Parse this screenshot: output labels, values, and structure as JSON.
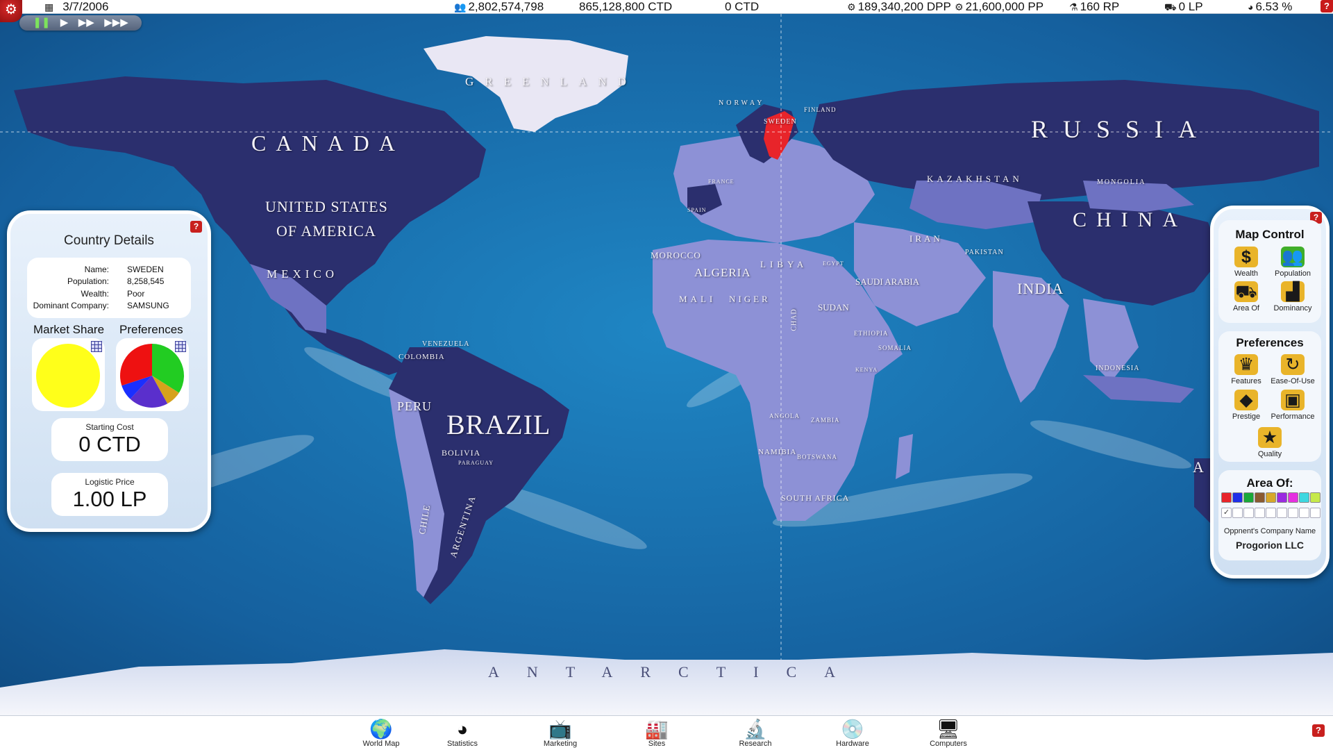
{
  "topbar": {
    "date": "3/7/2006",
    "population": "2,802,574,798",
    "money": "865,128,800 CTD",
    "money2": "0 CTD",
    "dpp": "189,340,200 DPP",
    "pp": "21,600,000 PP",
    "rp": "160 RP",
    "lp": "0 LP",
    "percent": "6.53 %",
    "help": "?"
  },
  "speed": {
    "pause": "❚❚",
    "play": "▶",
    "fast": "▶▶",
    "fastest": "▶▶▶"
  },
  "map_labels": {
    "greenland": "GREENLAND",
    "canada": "CANADA",
    "usa_line1": "UNITED STATES",
    "usa_line2": "OF AMERICA",
    "mexico": "MEXICO",
    "russia": "RUSSIA",
    "china": "CHINA",
    "kazakhstan": "KAZAKHSTAN",
    "mongolia": "MONGOLIA",
    "iran": "IRAN",
    "pakistan": "PAKISTAN",
    "india": "INDIA",
    "indonesia": "INDONESIA",
    "norway": "NORWAY",
    "finland": "FINLAND",
    "sweden": "SWEDEN",
    "france": "FRANCE",
    "spain": "SPAIN",
    "morocco": "MOROCCO",
    "algeria": "ALGERIA",
    "libya": "LIBYA",
    "egypt": "EGYPT",
    "saudi_arabia": "SAUDI ARABIA",
    "mali": "MALI",
    "niger": "NIGER",
    "chad": "CHAD",
    "sudan": "SUDAN",
    "ethiopia": "ETHIOPIA",
    "somalia": "SOMALIA",
    "kenya": "KENYA",
    "angola": "ANGOLA",
    "zambia": "ZAMBIA",
    "namibia": "NAMIBIA",
    "botswana": "BOTSWANA",
    "south_africa": "SOUTH AFRICA",
    "venezuela": "VENEZUELA",
    "colombia": "COLOMBIA",
    "peru": "PERU",
    "brazil": "BRAZIL",
    "bolivia": "BOLIVIA",
    "paraguay": "PARAGUAY",
    "chile": "CHILE",
    "argentina": "ARGENTINA",
    "antarctica": "ANTARCTICA",
    "australia": "A"
  },
  "country_details": {
    "title": "Country Details",
    "name_label": "Name:",
    "name": "SWEDEN",
    "population_label": "Population:",
    "population": "8,258,545",
    "wealth_label": "Wealth:",
    "wealth": "Poor",
    "dominant_label": "Dominant Company:",
    "dominant": "SAMSUNG",
    "market_share_label": "Market Share",
    "preferences_label": "Preferences",
    "starting_cost_label": "Starting Cost",
    "starting_cost": "0 CTD",
    "logistic_price_label": "Logistic Price",
    "logistic_price": "1.00 LP",
    "help": "?"
  },
  "market_share_pie": [
    {
      "name": "SAMSUNG",
      "value": 100,
      "color": "#ffff1a"
    }
  ],
  "preferences_pie": [
    {
      "value": 34,
      "color": "#22cc22"
    },
    {
      "value": 8,
      "color": "#d6a21c"
    },
    {
      "value": 20,
      "color": "#5a2fcc"
    },
    {
      "value": 8,
      "color": "#1a2fff"
    },
    {
      "value": 30,
      "color": "#ee1111"
    }
  ],
  "map_control": {
    "title": "Map Control",
    "wealth": "Wealth",
    "population": "Population",
    "area_of": "Area Of",
    "dominancy": "Dominancy",
    "preferences_title": "Preferences",
    "features": "Features",
    "ease_of_use": "Ease-Of-Use",
    "prestige": "Prestige",
    "performance": "Performance",
    "quality": "Quality",
    "area_title": "Area Of:",
    "opponent_label": "Oppnent's Company Name",
    "opponent_name": "Progorion LLC",
    "help": "?",
    "swatches": [
      "#e8242a",
      "#1f2fe8",
      "#1aa83a",
      "#8a5a32",
      "#d7a82a",
      "#9a2be0",
      "#e62fe0",
      "#3dd7e0",
      "#c6ea4a"
    ]
  },
  "bottombar": {
    "world_map": "World Map",
    "statistics": "Statistics",
    "marketing": "Marketing",
    "sites": "Sites",
    "research": "Research",
    "hardware": "Hardware",
    "computers": "Computers",
    "help": "?"
  },
  "colors": {
    "ocean": "#1a6aa8",
    "land_dark": "#2b2f6e",
    "land_light": "#8d91d6",
    "highlight": "#e8242a"
  }
}
